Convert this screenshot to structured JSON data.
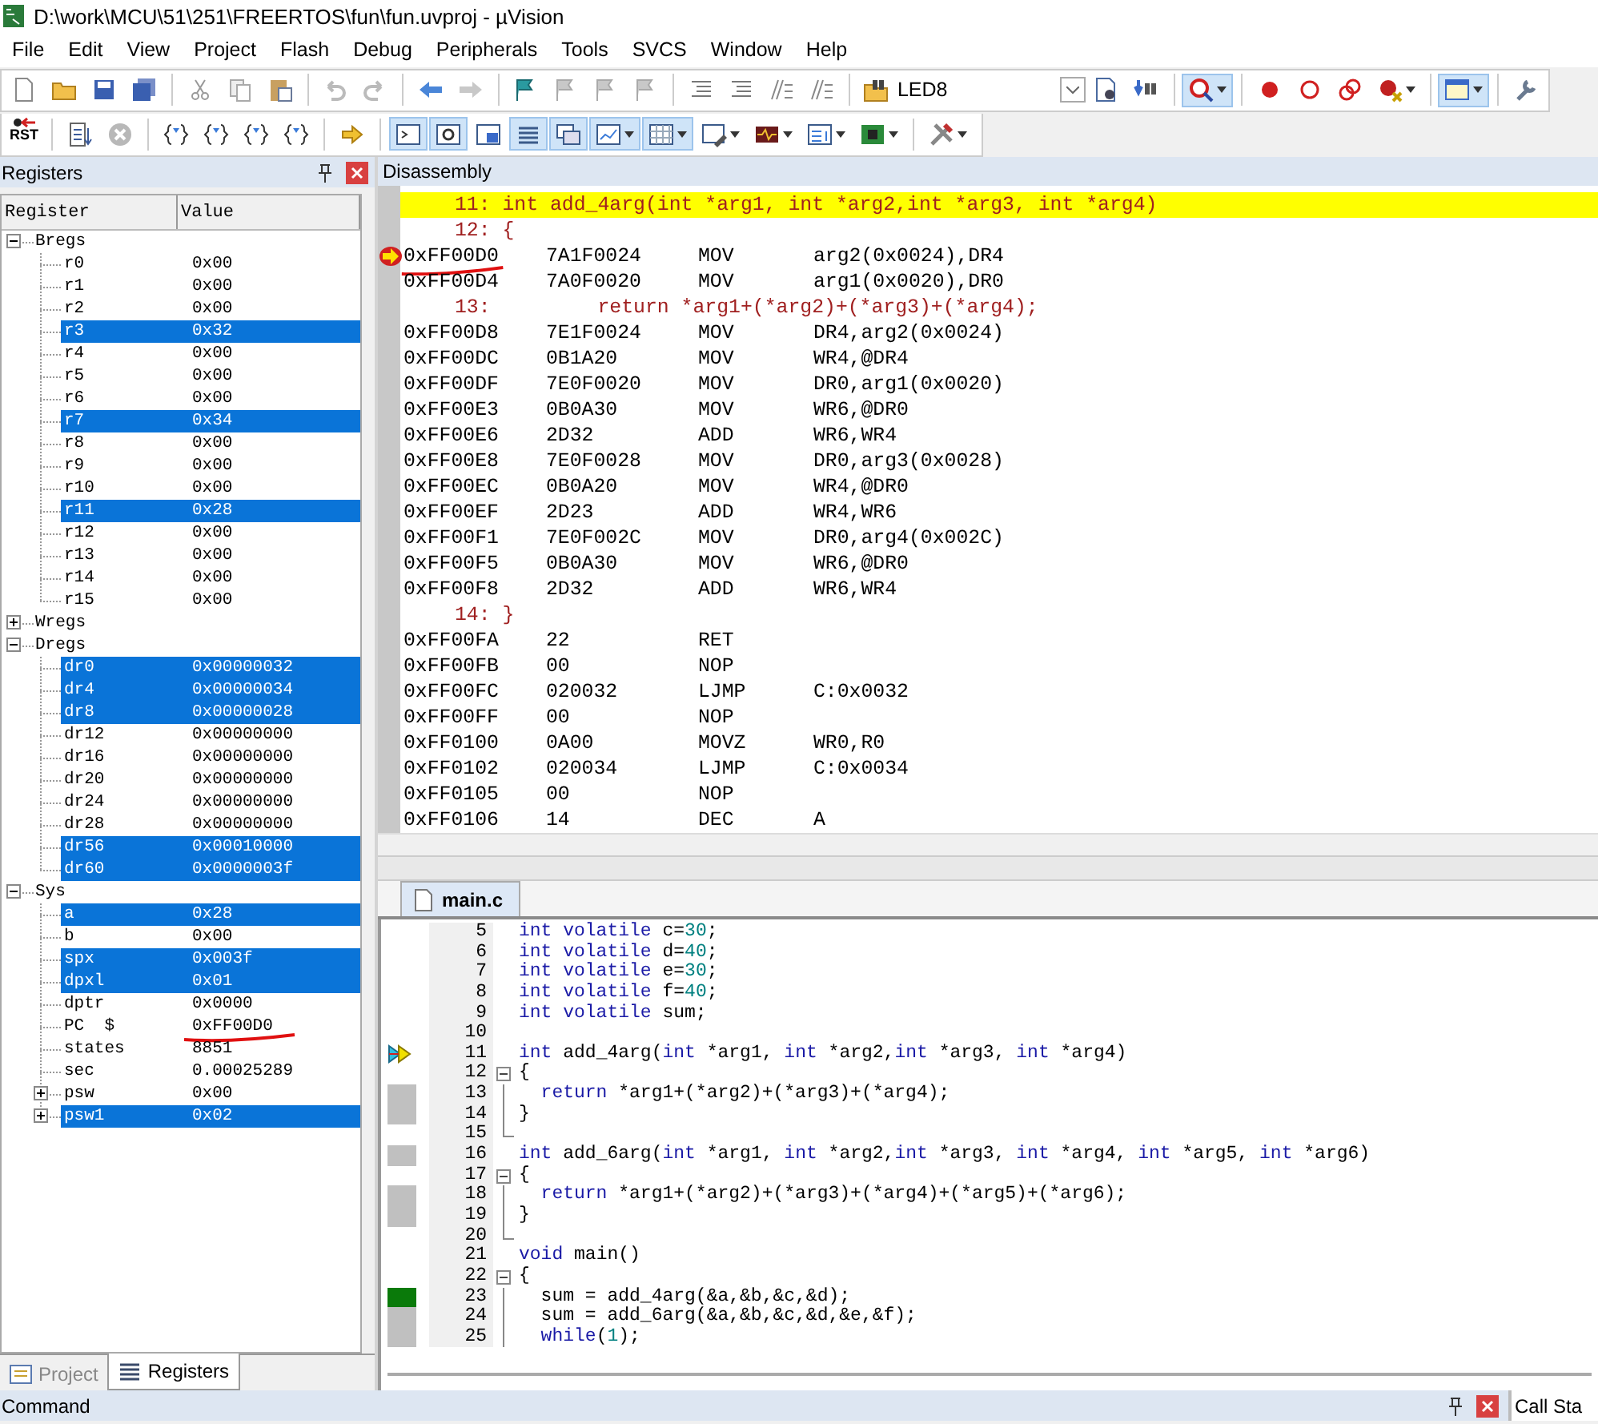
{
  "window": {
    "title": "D:\\work\\MCU\\51\\251\\FREERTOS\\fun\\fun.uvproj - µVision"
  },
  "menu": [
    "File",
    "Edit",
    "View",
    "Project",
    "Flash",
    "Debug",
    "Peripherals",
    "Tools",
    "SVCS",
    "Window",
    "Help"
  ],
  "toolbar": {
    "target": "LED8",
    "reset_label": "RST"
  },
  "registers_panel": {
    "title": "Registers",
    "columns": [
      "Register",
      "Value"
    ],
    "tree": [
      {
        "name": "Bregs",
        "expanded": true,
        "children": [
          {
            "name": "r0",
            "value": "0x00",
            "changed": false,
            "underlined": false
          },
          {
            "name": "r1",
            "value": "0x00",
            "changed": false,
            "underlined": false
          },
          {
            "name": "r2",
            "value": "0x00",
            "changed": false,
            "underlined": false
          },
          {
            "name": "r3",
            "value": "0x32",
            "changed": true,
            "underlined": false
          },
          {
            "name": "r4",
            "value": "0x00",
            "changed": false,
            "underlined": false
          },
          {
            "name": "r5",
            "value": "0x00",
            "changed": false,
            "underlined": false
          },
          {
            "name": "r6",
            "value": "0x00",
            "changed": false,
            "underlined": false
          },
          {
            "name": "r7",
            "value": "0x34",
            "changed": true,
            "underlined": false
          },
          {
            "name": "r8",
            "value": "0x00",
            "changed": false,
            "underlined": false
          },
          {
            "name": "r9",
            "value": "0x00",
            "changed": false,
            "underlined": false
          },
          {
            "name": "r10",
            "value": "0x00",
            "changed": false,
            "underlined": false
          },
          {
            "name": "r11",
            "value": "0x28",
            "changed": true,
            "underlined": false
          },
          {
            "name": "r12",
            "value": "0x00",
            "changed": false,
            "underlined": false
          },
          {
            "name": "r13",
            "value": "0x00",
            "changed": false,
            "underlined": false
          },
          {
            "name": "r14",
            "value": "0x00",
            "changed": false,
            "underlined": false
          },
          {
            "name": "r15",
            "value": "0x00",
            "changed": false,
            "underlined": false
          }
        ]
      },
      {
        "name": "Wregs",
        "expanded": false
      },
      {
        "name": "Dregs",
        "expanded": true,
        "children": [
          {
            "name": "dr0",
            "value": "0x00000032",
            "changed": true,
            "underlined": false
          },
          {
            "name": "dr4",
            "value": "0x00000034",
            "changed": true,
            "underlined": false
          },
          {
            "name": "dr8",
            "value": "0x00000028",
            "changed": true,
            "underlined": false
          },
          {
            "name": "dr12",
            "value": "0x00000000",
            "changed": false,
            "underlined": false
          },
          {
            "name": "dr16",
            "value": "0x00000000",
            "changed": false,
            "underlined": false
          },
          {
            "name": "dr20",
            "value": "0x00000000",
            "changed": false,
            "underlined": false
          },
          {
            "name": "dr24",
            "value": "0x00000000",
            "changed": false,
            "underlined": false
          },
          {
            "name": "dr28",
            "value": "0x00000000",
            "changed": false,
            "underlined": false
          },
          {
            "name": "dr56",
            "value": "0x00010000",
            "changed": true,
            "underlined": false
          },
          {
            "name": "dr60",
            "value": "0x0000003f",
            "changed": true,
            "underlined": false
          }
        ]
      },
      {
        "name": "Sys",
        "expanded": true,
        "children": [
          {
            "name": "a",
            "value": "0x28",
            "changed": true,
            "underlined": false
          },
          {
            "name": "b",
            "value": "0x00",
            "changed": false,
            "underlined": false
          },
          {
            "name": "spx",
            "value": "0x003f",
            "changed": true,
            "underlined": false
          },
          {
            "name": "dpxl",
            "value": "0x01",
            "changed": true,
            "underlined": false
          },
          {
            "name": "dptr",
            "value": "0x0000",
            "changed": false,
            "underlined": false
          },
          {
            "name": "PC  $",
            "value": "0xFF00D0",
            "changed": false,
            "underlined": true
          },
          {
            "name": "states",
            "value": "8851",
            "changed": false,
            "underlined": false
          },
          {
            "name": "sec",
            "value": "0.00025289",
            "changed": false,
            "underlined": false
          },
          {
            "name": "psw",
            "value": "0x00",
            "changed": false,
            "underlined": false,
            "expanded": false
          },
          {
            "name": "psw1",
            "value": "0x02",
            "changed": true,
            "underlined": false,
            "expanded": false
          }
        ]
      }
    ],
    "tabs": [
      {
        "label": "Project",
        "selected": false
      },
      {
        "label": "Registers",
        "selected": true
      }
    ]
  },
  "disassembly": {
    "title": "Disassembly",
    "rows": [
      {
        "kind": "source",
        "text": "11: int add_4arg(int *arg1, int *arg2,int *arg3, int *arg4)",
        "selected": true
      },
      {
        "kind": "source",
        "text": "12: {",
        "selected": false
      },
      {
        "kind": "instruction",
        "address": "0xFF00D0",
        "code": "7A1F0024",
        "mnemonic": "MOV",
        "operand": "arg2(0x0024),DR4",
        "current": true,
        "underlined": true
      },
      {
        "kind": "instruction",
        "address": "0xFF00D4",
        "code": "7A0F0020",
        "mnemonic": "MOV",
        "operand": "arg1(0x0020),DR0",
        "current": false,
        "underlined": false
      },
      {
        "kind": "source",
        "text": "13:         return *arg1+(*arg2)+(*arg3)+(*arg4);",
        "selected": false
      },
      {
        "kind": "instruction",
        "address": "0xFF00D8",
        "code": "7E1F0024",
        "mnemonic": "MOV",
        "operand": "DR4,arg2(0x0024)",
        "current": false,
        "underlined": false
      },
      {
        "kind": "instruction",
        "address": "0xFF00DC",
        "code": "0B1A20",
        "mnemonic": "MOV",
        "operand": "WR4,@DR4",
        "current": false,
        "underlined": false
      },
      {
        "kind": "instruction",
        "address": "0xFF00DF",
        "code": "7E0F0020",
        "mnemonic": "MOV",
        "operand": "DR0,arg1(0x0020)",
        "current": false,
        "underlined": false
      },
      {
        "kind": "instruction",
        "address": "0xFF00E3",
        "code": "0B0A30",
        "mnemonic": "MOV",
        "operand": "WR6,@DR0",
        "current": false,
        "underlined": false
      },
      {
        "kind": "instruction",
        "address": "0xFF00E6",
        "code": "2D32",
        "mnemonic": "ADD",
        "operand": "WR6,WR4",
        "current": false,
        "underlined": false
      },
      {
        "kind": "instruction",
        "address": "0xFF00E8",
        "code": "7E0F0028",
        "mnemonic": "MOV",
        "operand": "DR0,arg3(0x0028)",
        "current": false,
        "underlined": false
      },
      {
        "kind": "instruction",
        "address": "0xFF00EC",
        "code": "0B0A20",
        "mnemonic": "MOV",
        "operand": "WR4,@DR0",
        "current": false,
        "underlined": false
      },
      {
        "kind": "instruction",
        "address": "0xFF00EF",
        "code": "2D23",
        "mnemonic": "ADD",
        "operand": "WR4,WR6",
        "current": false,
        "underlined": false
      },
      {
        "kind": "instruction",
        "address": "0xFF00F1",
        "code": "7E0F002C",
        "mnemonic": "MOV",
        "operand": "DR0,arg4(0x002C)",
        "current": false,
        "underlined": false
      },
      {
        "kind": "instruction",
        "address": "0xFF00F5",
        "code": "0B0A30",
        "mnemonic": "MOV",
        "operand": "WR6,@DR0",
        "current": false,
        "underlined": false
      },
      {
        "kind": "instruction",
        "address": "0xFF00F8",
        "code": "2D32",
        "mnemonic": "ADD",
        "operand": "WR6,WR4",
        "current": false,
        "underlined": false
      },
      {
        "kind": "source",
        "text": "14: }",
        "selected": false
      },
      {
        "kind": "instruction",
        "address": "0xFF00FA",
        "code": "22",
        "mnemonic": "RET",
        "current": false,
        "underlined": false
      },
      {
        "kind": "instruction",
        "address": "0xFF00FB",
        "code": "00",
        "mnemonic": "NOP",
        "current": false,
        "underlined": false
      },
      {
        "kind": "instruction",
        "address": "0xFF00FC",
        "code": "020032",
        "mnemonic": "LJMP",
        "operand": "C:0x0032",
        "current": false,
        "underlined": false
      },
      {
        "kind": "instruction",
        "address": "0xFF00FF",
        "code": "00",
        "mnemonic": "NOP",
        "current": false,
        "underlined": false
      },
      {
        "kind": "instruction",
        "address": "0xFF0100",
        "code": "0A00",
        "mnemonic": "MOVZ",
        "operand": "WR0,R0",
        "current": false,
        "underlined": false
      },
      {
        "kind": "instruction",
        "address": "0xFF0102",
        "code": "020034",
        "mnemonic": "LJMP",
        "operand": "C:0x0034",
        "current": false,
        "underlined": false
      },
      {
        "kind": "instruction",
        "address": "0xFF0105",
        "code": "00",
        "mnemonic": "NOP",
        "current": false,
        "underlined": false
      },
      {
        "kind": "instruction",
        "address": "0xFF0106",
        "code": "14",
        "mnemonic": "DEC",
        "operand": "A",
        "current": false,
        "underlined": false
      }
    ]
  },
  "editor": {
    "tabs": [
      {
        "label": "main.c",
        "selected": true
      }
    ],
    "lines": [
      {
        "number": "5",
        "parts": [
          {
            "t": "int volatile",
            "kind": "kw"
          },
          {
            "t": " c=",
            "kind": "text"
          },
          {
            "t": "30",
            "kind": "num"
          },
          {
            "t": ";",
            "kind": "text"
          }
        ]
      },
      {
        "number": "6",
        "parts": [
          {
            "t": "int volatile",
            "kind": "kw"
          },
          {
            "t": " d=",
            "kind": "text"
          },
          {
            "t": "40",
            "kind": "num"
          },
          {
            "t": ";",
            "kind": "text"
          }
        ]
      },
      {
        "number": "7",
        "parts": [
          {
            "t": "int volatile",
            "kind": "kw"
          },
          {
            "t": " e=",
            "kind": "text"
          },
          {
            "t": "30",
            "kind": "num"
          },
          {
            "t": ";",
            "kind": "text"
          }
        ]
      },
      {
        "number": "8",
        "parts": [
          {
            "t": "int volatile",
            "kind": "kw"
          },
          {
            "t": " f=",
            "kind": "text"
          },
          {
            "t": "40",
            "kind": "num"
          },
          {
            "t": ";",
            "kind": "text"
          }
        ]
      },
      {
        "number": "9",
        "parts": [
          {
            "t": "int volatile",
            "kind": "kw"
          },
          {
            "t": " sum;",
            "kind": "text"
          }
        ]
      },
      {
        "number": "10"
      },
      {
        "number": "11",
        "gutter": {
          "kind": "current"
        },
        "parts": [
          {
            "t": "int",
            "kind": "kw"
          },
          {
            "t": " add_4arg(",
            "kind": "text"
          },
          {
            "t": "int",
            "kind": "kw"
          },
          {
            "t": " *arg1, ",
            "kind": "text"
          },
          {
            "t": "int",
            "kind": "kw"
          },
          {
            "t": " *arg2,",
            "kind": "text"
          },
          {
            "t": "int",
            "kind": "kw"
          },
          {
            "t": " *arg3, ",
            "kind": "text"
          },
          {
            "t": "int",
            "kind": "kw"
          },
          {
            "t": " *arg4)",
            "kind": "text"
          }
        ]
      },
      {
        "number": "12",
        "fold": {
          "kind": "start"
        },
        "parts": [
          {
            "t": "{",
            "kind": "text"
          }
        ]
      },
      {
        "number": "13",
        "gutter": {
          "kind": "covered"
        },
        "fold": {
          "kind": "line"
        },
        "parts": [
          {
            "t": "  return",
            "kind": "kw"
          },
          {
            "t": " *arg1+(*arg2)+(*arg3)+(*arg4);",
            "kind": "text"
          }
        ]
      },
      {
        "number": "14",
        "gutter": {
          "kind": "covered"
        },
        "fold": {
          "kind": "line"
        },
        "parts": [
          {
            "t": "}",
            "kind": "text"
          }
        ]
      },
      {
        "number": "15",
        "fold": {
          "kind": "end"
        }
      },
      {
        "number": "16",
        "gutter": {
          "kind": "covered"
        },
        "parts": [
          {
            "t": "int",
            "kind": "kw"
          },
          {
            "t": " add_6arg(",
            "kind": "text"
          },
          {
            "t": "int",
            "kind": "kw"
          },
          {
            "t": " *arg1, ",
            "kind": "text"
          },
          {
            "t": "int",
            "kind": "kw"
          },
          {
            "t": " *arg2,",
            "kind": "text"
          },
          {
            "t": "int",
            "kind": "kw"
          },
          {
            "t": " *arg3, ",
            "kind": "text"
          },
          {
            "t": "int",
            "kind": "kw"
          },
          {
            "t": " *arg4, ",
            "kind": "text"
          },
          {
            "t": "int",
            "kind": "kw"
          },
          {
            "t": " *arg5, ",
            "kind": "text"
          },
          {
            "t": "int",
            "kind": "kw"
          },
          {
            "t": " *arg6)",
            "kind": "text"
          }
        ]
      },
      {
        "number": "17",
        "fold": {
          "kind": "start"
        },
        "parts": [
          {
            "t": "{",
            "kind": "text"
          }
        ]
      },
      {
        "number": "18",
        "gutter": {
          "kind": "covered"
        },
        "fold": {
          "kind": "line"
        },
        "parts": [
          {
            "t": "  return",
            "kind": "kw"
          },
          {
            "t": " *arg1+(*arg2)+(*arg3)+(*arg4)+(*arg5)+(*arg6);",
            "kind": "text"
          }
        ]
      },
      {
        "number": "19",
        "gutter": {
          "kind": "covered"
        },
        "fold": {
          "kind": "line"
        },
        "parts": [
          {
            "t": "}",
            "kind": "text"
          }
        ]
      },
      {
        "number": "20",
        "fold": {
          "kind": "end"
        }
      },
      {
        "number": "21",
        "parts": [
          {
            "t": "void",
            "kind": "kw"
          },
          {
            "t": " main()",
            "kind": "text"
          }
        ]
      },
      {
        "number": "22",
        "fold": {
          "kind": "start"
        },
        "parts": [
          {
            "t": "{",
            "kind": "text"
          }
        ]
      },
      {
        "number": "23",
        "gutter": {
          "kind": "executed"
        },
        "fold": {
          "kind": "line"
        },
        "parts": [
          {
            "t": "  sum = add_4arg(&a,&b,&c,&d);",
            "kind": "text"
          }
        ]
      },
      {
        "number": "24",
        "gutter": {
          "kind": "covered"
        },
        "fold": {
          "kind": "line"
        },
        "parts": [
          {
            "t": "  sum = add_6arg(&a,&b,&c,&d,&e,&f);",
            "kind": "text"
          }
        ]
      },
      {
        "number": "25",
        "gutter": {
          "kind": "covered"
        },
        "fold": {
          "kind": "line"
        },
        "parts": [
          {
            "t": "  while",
            "kind": "kw"
          },
          {
            "t": "(",
            "kind": "text"
          },
          {
            "t": "1",
            "kind": "num"
          },
          {
            "t": ");",
            "kind": "text"
          }
        ]
      }
    ]
  },
  "bottom": {
    "command_title": "Command",
    "call_stack_tab": "Call Sta"
  }
}
